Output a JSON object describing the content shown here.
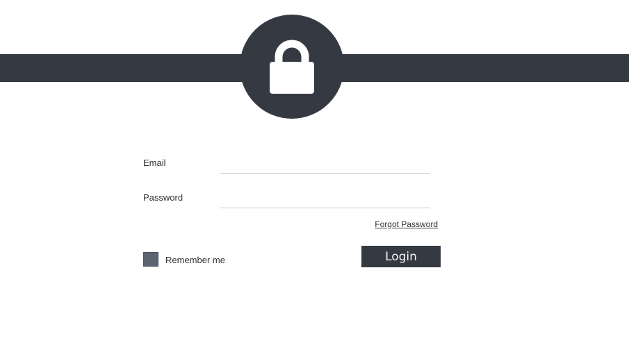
{
  "header": {
    "lock_icon": "lock-icon",
    "band_color": "#353a42"
  },
  "form": {
    "email": {
      "label": "Email",
      "value": "",
      "placeholder": ""
    },
    "password": {
      "label": "Password",
      "value": "",
      "placeholder": ""
    },
    "forgot_password_label": "Forgot Password",
    "remember_me": {
      "label": "Remember me",
      "checked": false
    },
    "login_label": "Login"
  },
  "colors": {
    "accent": "#353a42",
    "checkbox": "#5b6470",
    "background": "#ffffff"
  }
}
